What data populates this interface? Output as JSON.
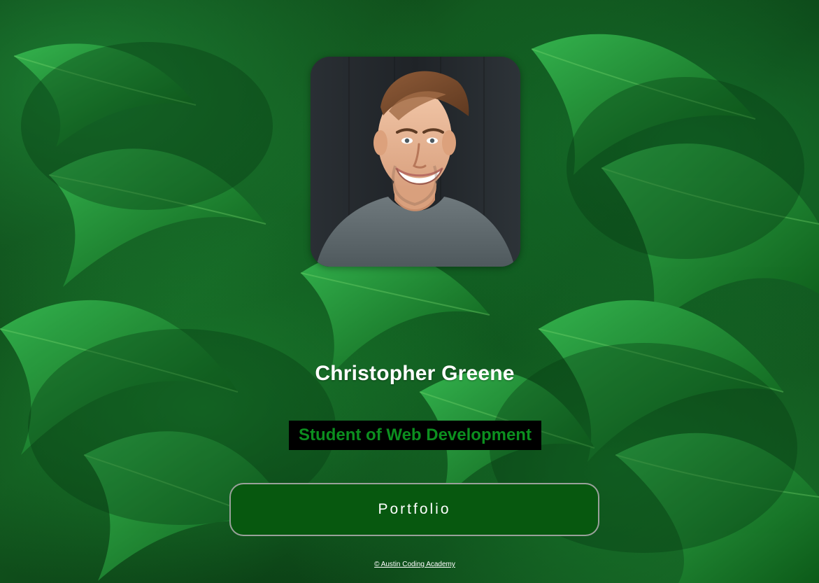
{
  "profile": {
    "name": "Christopher Greene",
    "subtitle": "Student of Web Development",
    "portfolio_button_label": "Portfolio"
  },
  "footer": {
    "link_text": "© Austin Coding Academy"
  },
  "colors": {
    "subtitle_background": "#000000",
    "subtitle_text": "#0c8f1f",
    "button_background": "#07580f",
    "page_accent": "#11541d"
  },
  "icons": {
    "avatar_image": "portrait-photo"
  }
}
